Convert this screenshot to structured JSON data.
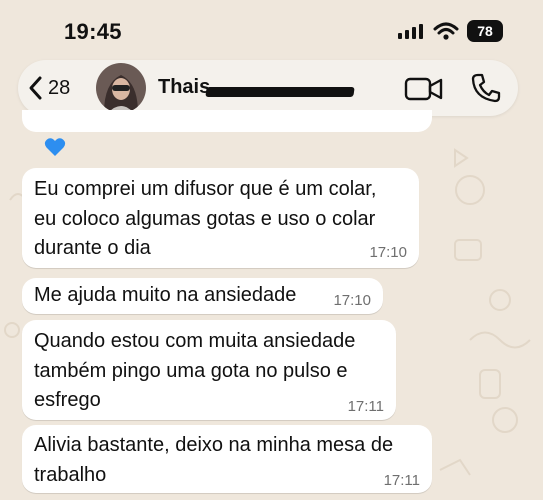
{
  "status_bar": {
    "time": "19:45",
    "battery": "78"
  },
  "header": {
    "back_count": "28",
    "contact_name": "Thais,"
  },
  "messages": [
    {
      "text": "Eu comprei um difusor que é um colar,\neu coloco algumas gotas e uso o colar\ndurante o dia",
      "time": "17:10"
    },
    {
      "text": "Me ajuda muito na ansiedade",
      "time": "17:10"
    },
    {
      "text": "Quando estou com muita ansiedade\ntambém pingo uma gota no pulso e\nesfrego",
      "time": "17:11"
    },
    {
      "text": "Alivia bastante, deixo na minha mesa de\ntrabalho",
      "time": "17:11"
    }
  ],
  "colors": {
    "background": "#efe7dc",
    "bubble": "#ffffff",
    "reaction_heart": "#2d8ef0"
  },
  "icons": [
    "signal-icon",
    "wifi-icon",
    "battery-icon",
    "back-chevron-icon",
    "video-call-icon",
    "phone-icon",
    "blue-heart-icon"
  ]
}
